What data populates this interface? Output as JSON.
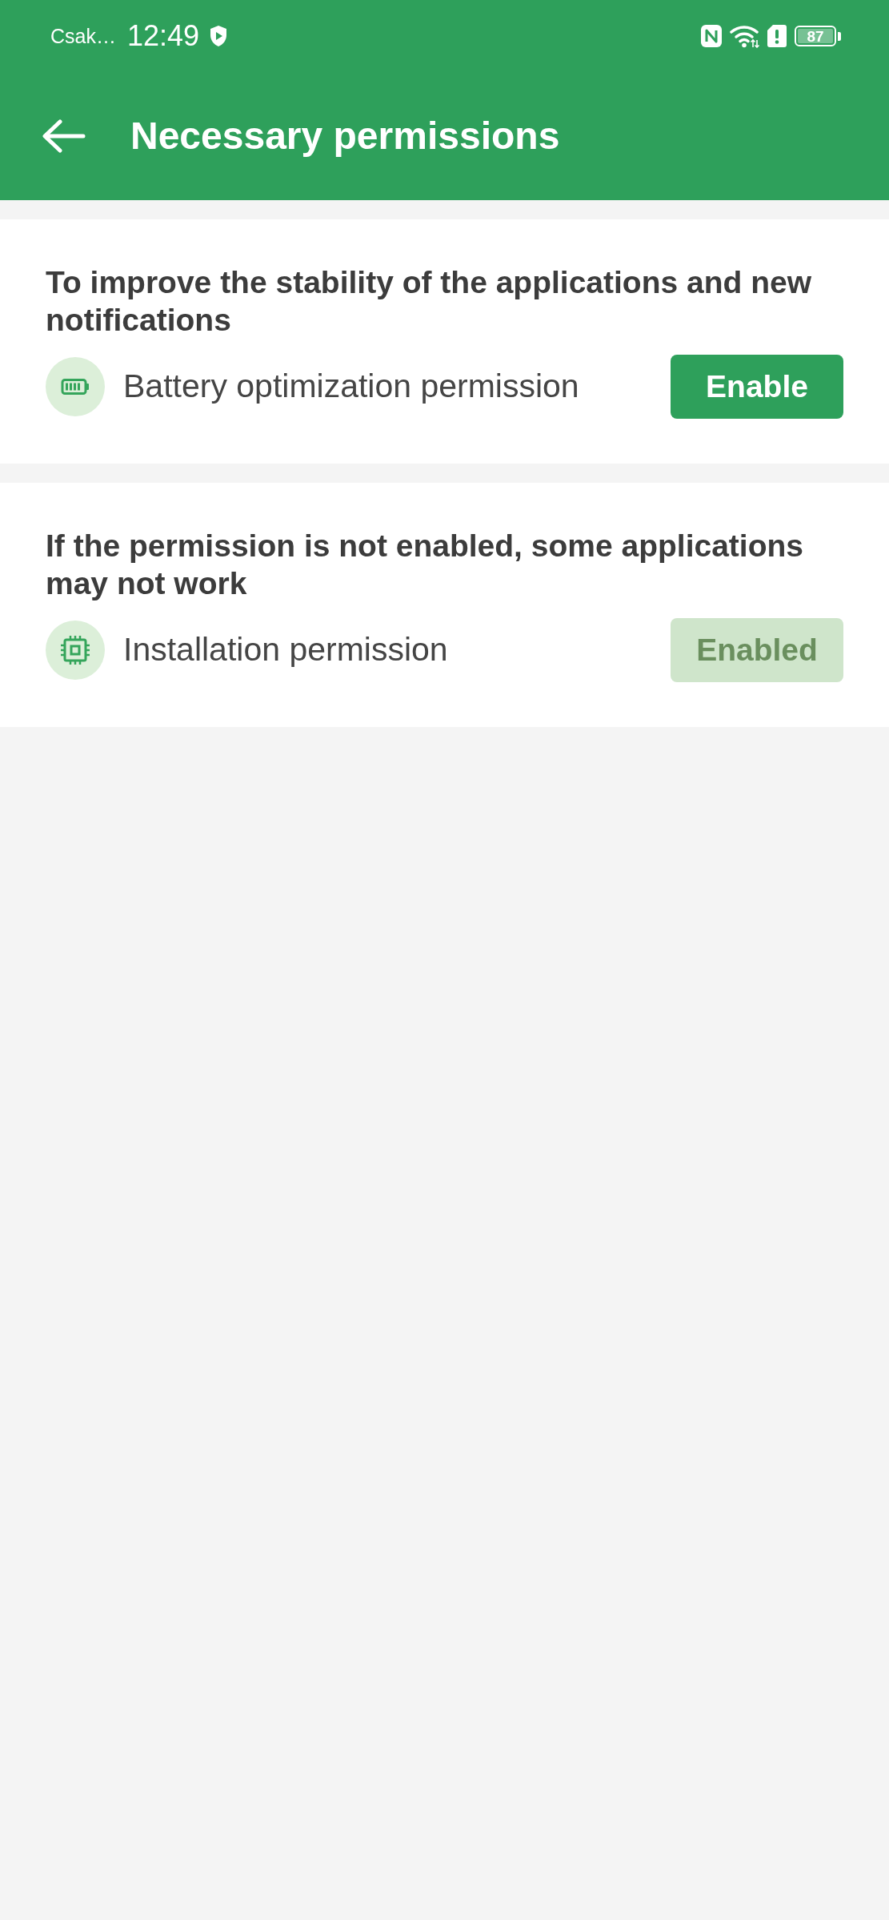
{
  "status_bar": {
    "carrier": "Csak…",
    "time": "12:49",
    "battery": "87"
  },
  "app_bar": {
    "title": "Necessary permissions"
  },
  "sections": [
    {
      "heading": "To improve the stability of the applications and new notifications",
      "permission": {
        "kind": "battery",
        "label": "Battery optimization permission",
        "button": "Enable",
        "granted": false
      }
    },
    {
      "heading": "If the permission is not enabled, some applications may not work",
      "permission": {
        "kind": "chip",
        "label": "Installation permission",
        "button": "Enabled",
        "granted": true
      }
    }
  ]
}
